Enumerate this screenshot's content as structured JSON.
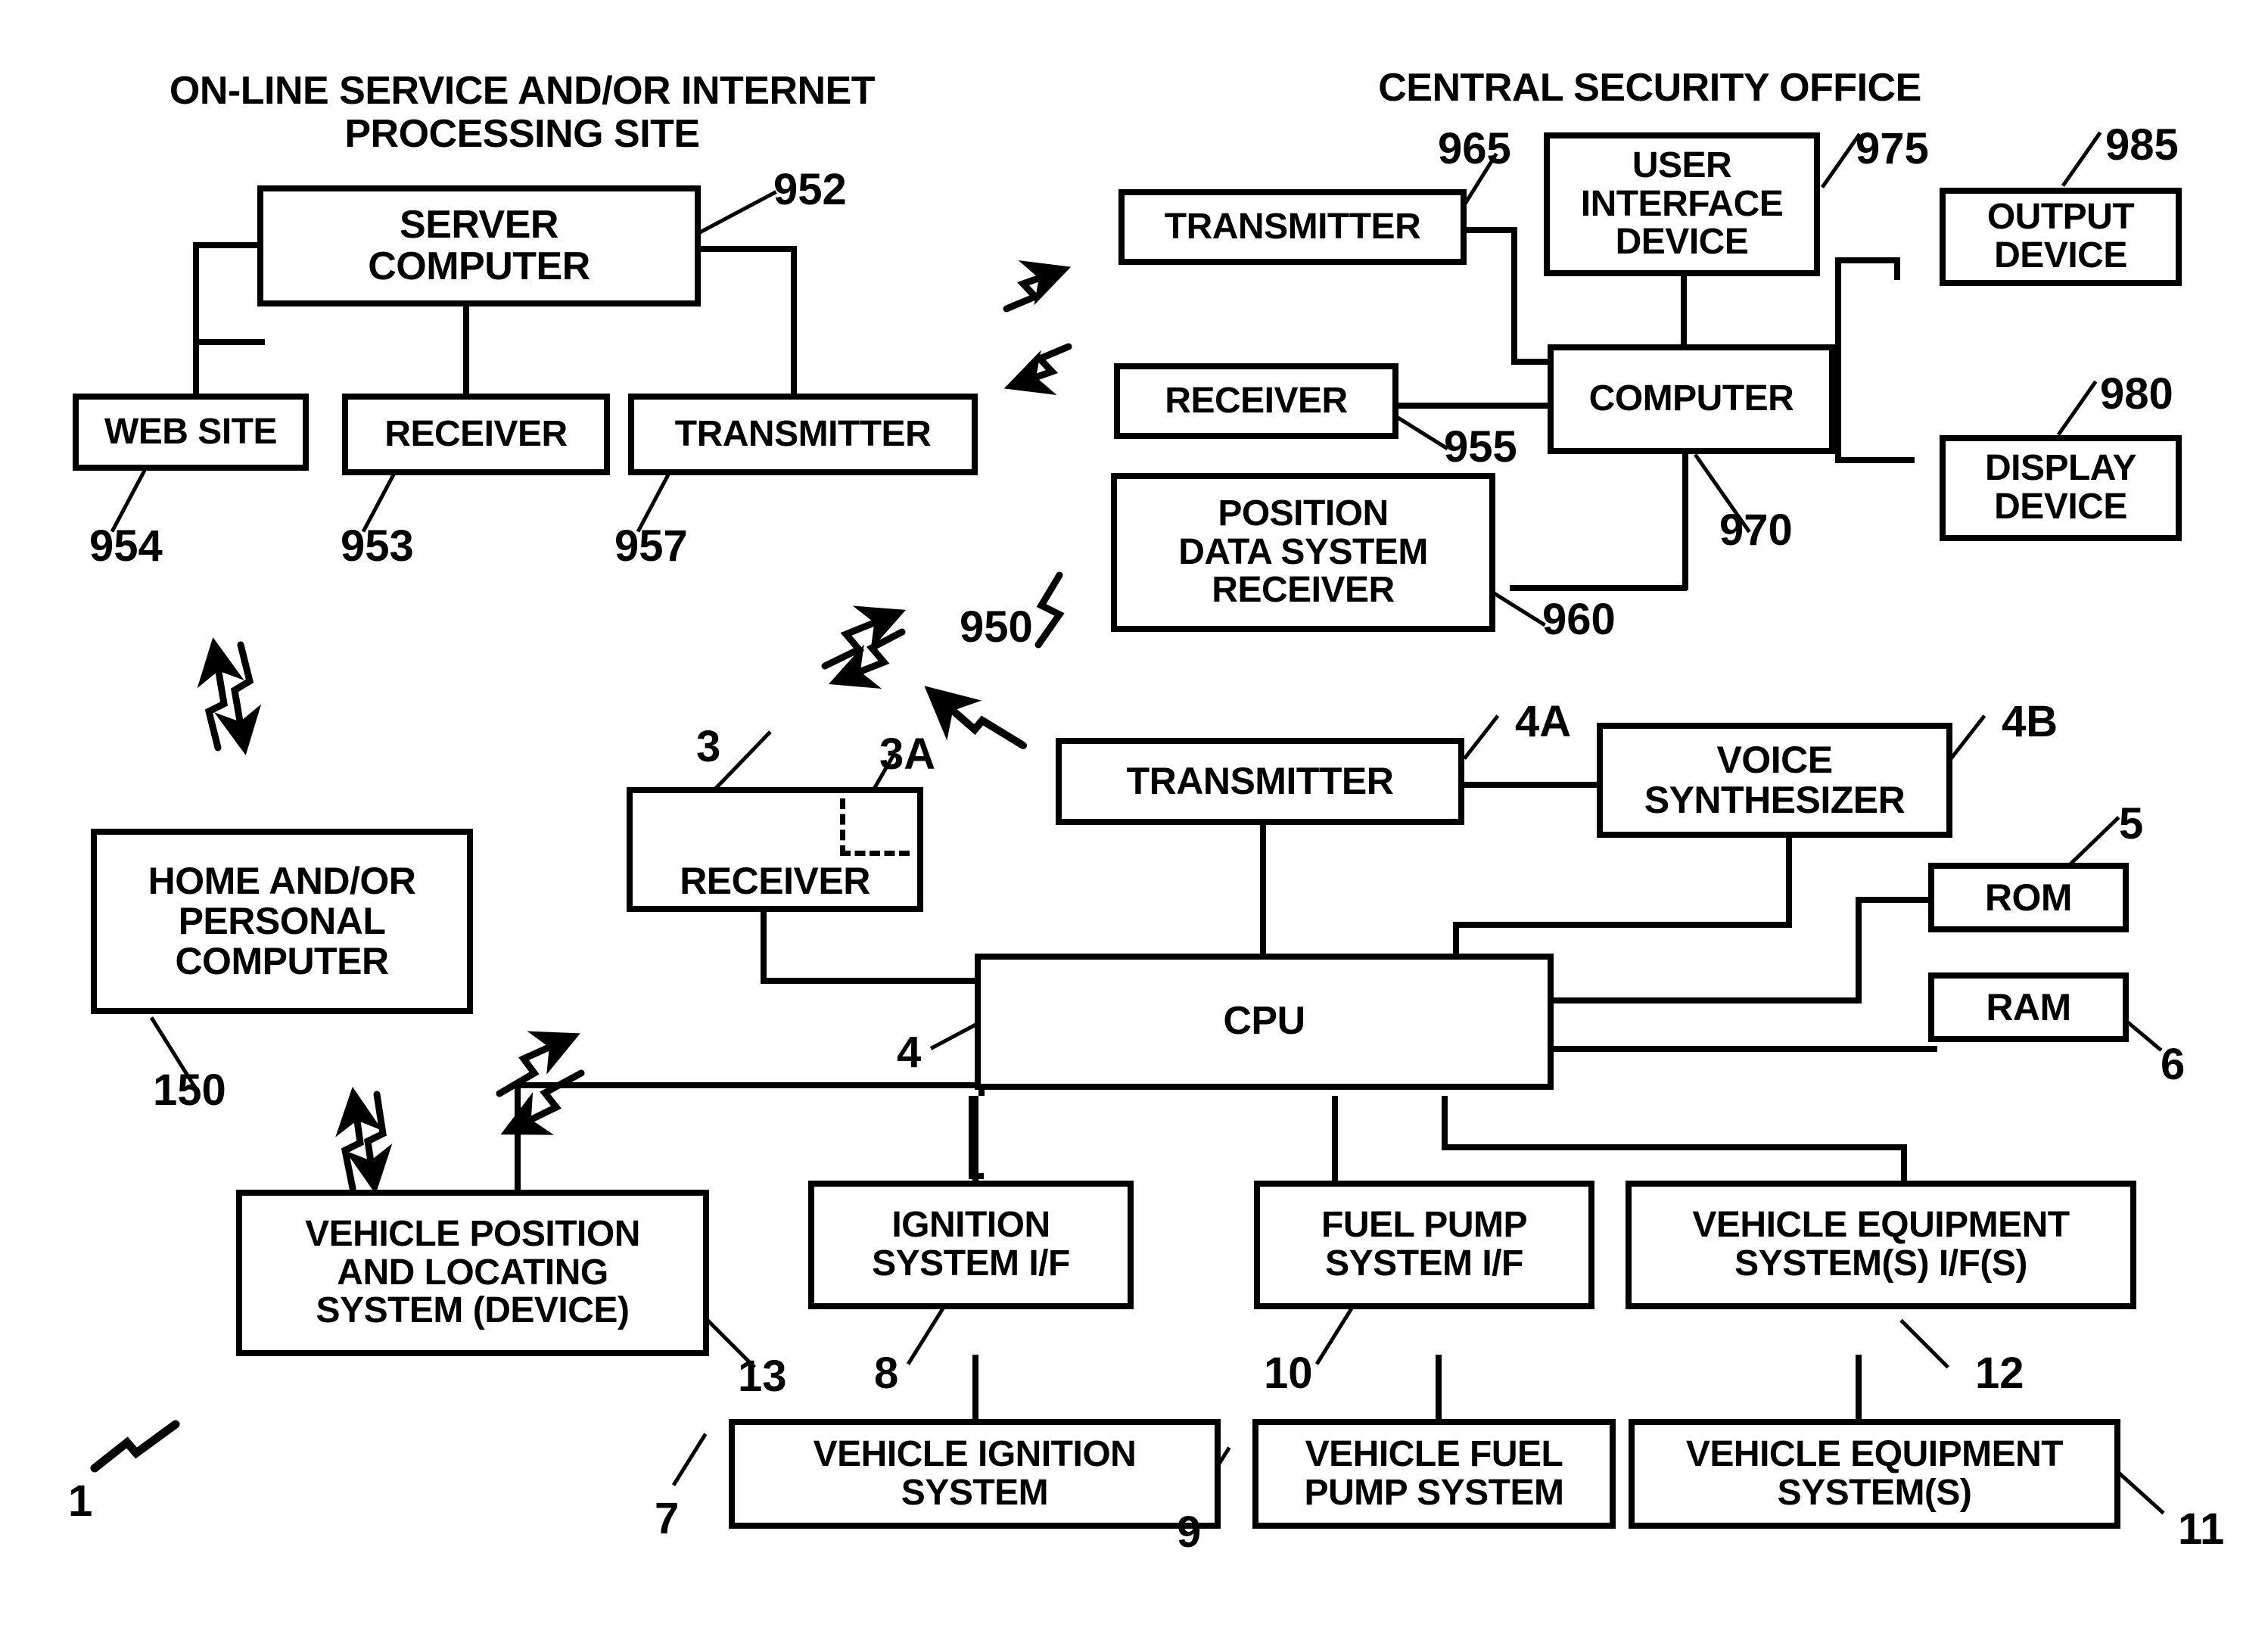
{
  "figure": {
    "panels": [
      {
        "id": "online-service",
        "title": "ON-LINE SERVICE AND/OR INTERNET\nPROCESSING SITE"
      },
      {
        "id": "central-security-office",
        "title": "CENTRAL SECURITY OFFICE"
      },
      {
        "id": "vehicle-system",
        "title": ""
      }
    ],
    "boxes": {
      "server_computer": "SERVER\nCOMPUTER",
      "web_site": "WEB SITE",
      "receiver_online": "RECEIVER",
      "transmitter_online": "TRANSMITTER",
      "transmitter_cso": "TRANSMITTER",
      "user_interface_device": "USER\nINTERFACE\nDEVICE",
      "output_device": "OUTPUT\nDEVICE",
      "receiver_cso": "RECEIVER",
      "computer_cso": "COMPUTER",
      "display_device": "DISPLAY\nDEVICE",
      "position_data_system_receiver": "POSITION\nDATA  SYSTEM\nRECEIVER",
      "home_personal_computer": "HOME AND/OR\nPERSONAL\nCOMPUTER",
      "receiver_vehicle": "RECEIVER",
      "transmitter_vehicle": "TRANSMITTER",
      "voice_synthesizer": "VOICE\nSYNTHESIZER",
      "rom": "ROM",
      "ram": "RAM",
      "cpu": "CPU",
      "vehicle_position_locating": "VEHICLE POSITION\nAND LOCATING\nSYSTEM (DEVICE)",
      "ignition_system_if": "IGNITION\nSYSTEM I/F",
      "fuel_pump_system_if": "FUEL PUMP\nSYSTEM I/F",
      "vehicle_equipment_systems_if": "VEHICLE EQUIPMENT\nSYSTEM(S) I/F(S)",
      "vehicle_ignition_system": "VEHICLE IGNITION\nSYSTEM",
      "vehicle_fuel_pump_system": "VEHICLE FUEL\nPUMP SYSTEM",
      "vehicle_equipment_systems": "VEHICLE EQUIPMENT\nSYSTEM(S)"
    },
    "refs": {
      "r952": "952",
      "r954": "954",
      "r953": "953",
      "r957": "957",
      "r965": "965",
      "r975": "975",
      "r985": "985",
      "r955": "955",
      "r970": "970",
      "r980": "980",
      "r960": "960",
      "r950": "950",
      "r150": "150",
      "r3": "3",
      "r3a": "3A",
      "r4": "4",
      "r4a": "4A",
      "r4b": "4B",
      "r5": "5",
      "r6": "6",
      "r13": "13",
      "r8": "8",
      "r10": "10",
      "r12": "12",
      "r7": "7",
      "r9": "9",
      "r11": "11",
      "r1": "1"
    },
    "colors": {
      "ink": "#000000",
      "paper": "#ffffff"
    }
  }
}
